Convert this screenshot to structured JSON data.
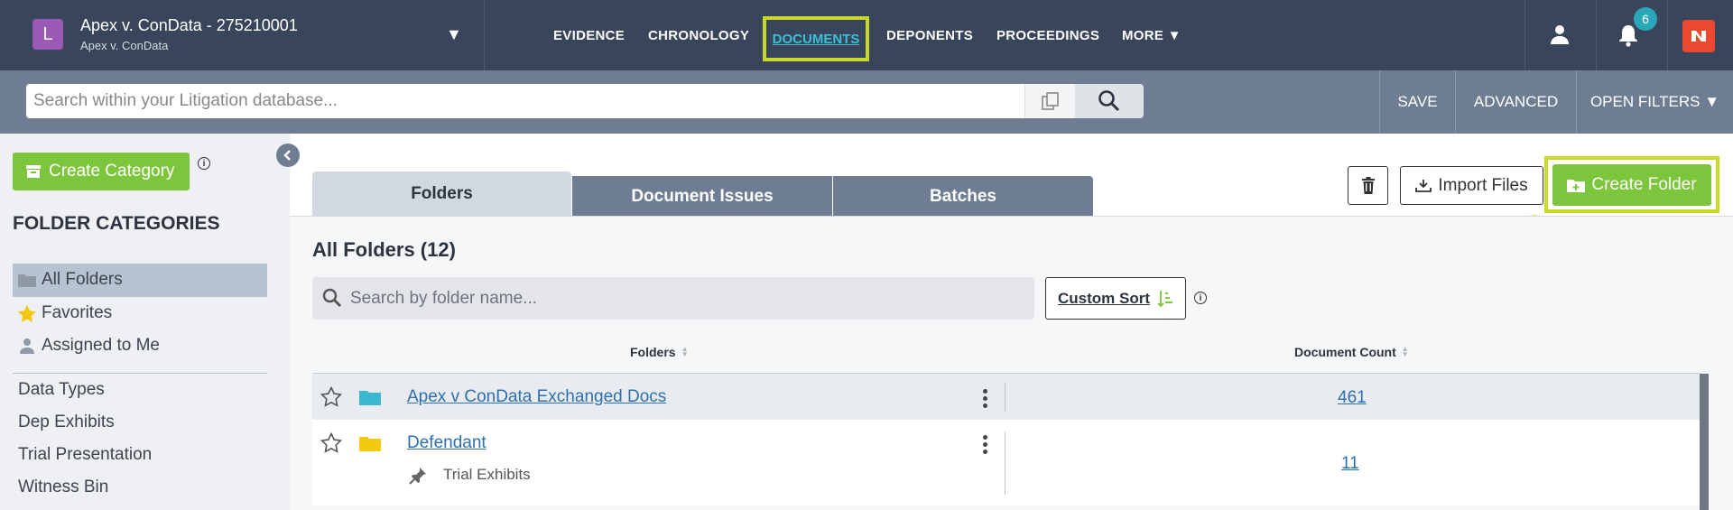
{
  "header": {
    "case_initial": "L",
    "case_title": "Apex v. ConData - 275210001",
    "case_subtitle": "Apex v. ConData",
    "nav": {
      "evidence": "EVIDENCE",
      "chronology": "CHRONOLOGY",
      "documents": "DOCUMENTS",
      "deponents": "DEPONENTS",
      "proceedings": "PROCEEDINGS",
      "more": "MORE ▼"
    },
    "notification_count": "6",
    "colors": {
      "bar": "#38455a",
      "active_nav": "#3bc0d8",
      "highlight": "#c8d92b",
      "brand": "#e8492f"
    }
  },
  "search": {
    "placeholder": "Search within your Litigation database...",
    "save": "SAVE",
    "advanced": "ADVANCED",
    "open_filters": "OPEN FILTERS ▼"
  },
  "sidebar": {
    "create_category": "Create Category",
    "heading": "FOLDER CATEGORIES",
    "primary_items": [
      {
        "label": "All Folders",
        "icon": "folder-icon",
        "active": true
      },
      {
        "label": "Favorites",
        "icon": "star-icon"
      },
      {
        "label": "Assigned to Me",
        "icon": "person-icon"
      }
    ],
    "categories": [
      "Data Types",
      "Dep Exhibits",
      "Trial Presentation",
      "Witness Bin"
    ]
  },
  "tabs": {
    "folders": "Folders",
    "document_issues": "Document Issues",
    "batches": "Batches"
  },
  "actions": {
    "import_files": "Import Files",
    "create_folder": "Create Folder"
  },
  "main": {
    "title": "All Folders (12)",
    "search_placeholder": "Search by folder name...",
    "custom_sort": "Custom Sort",
    "columns": {
      "folders": "Folders",
      "document_count": "Document Count"
    },
    "rows": [
      {
        "name": "Apex v ConData Exchanged Docs",
        "count": "461",
        "folder_color": "#3bb8cf"
      },
      {
        "name": "Defendant",
        "count": "11",
        "folder_color": "#f2c811",
        "subitem": "Trial Exhibits"
      }
    ]
  }
}
